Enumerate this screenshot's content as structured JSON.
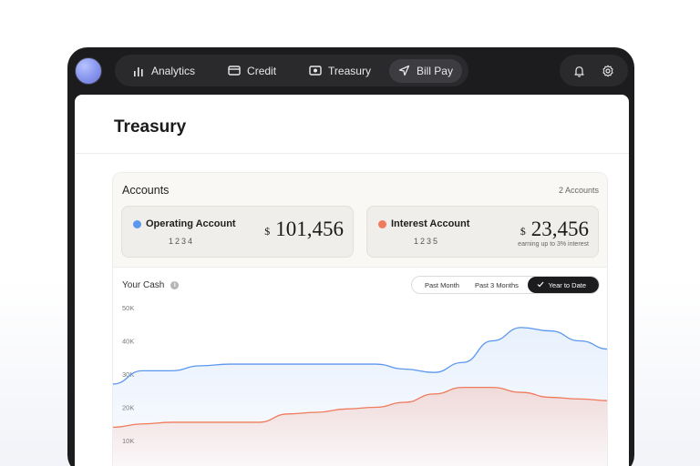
{
  "nav": {
    "items": [
      {
        "label": "Analytics",
        "icon": "bar-chart-icon"
      },
      {
        "label": "Credit",
        "icon": "credit-card-icon"
      },
      {
        "label": "Treasury",
        "icon": "cash-icon"
      },
      {
        "label": "Bill Pay",
        "icon": "send-icon",
        "active": true
      }
    ],
    "utilities": [
      {
        "icon": "bell-icon"
      },
      {
        "icon": "gear-icon"
      }
    ]
  },
  "page": {
    "title": "Treasury"
  },
  "accounts": {
    "title": "Accounts",
    "count_label": "2 Accounts",
    "items": [
      {
        "name": "Operating Account",
        "number": "1234",
        "currency": "$",
        "balance": "101,456",
        "note": "",
        "color": "#5b97ee"
      },
      {
        "name": "Interest Account",
        "number": "1235",
        "currency": "$",
        "balance": "23,456",
        "note": "earning up to 3% interest",
        "color": "#f07a5c"
      }
    ]
  },
  "cash": {
    "label": "Your Cash",
    "ranges": [
      {
        "label": "Past Month"
      },
      {
        "label": "Past 3 Months"
      },
      {
        "label": "Year to Date",
        "active": true
      }
    ]
  },
  "colors": {
    "operating": "#5b97ee",
    "interest": "#f07a5c",
    "dark": "#1c1c1e"
  },
  "chart_data": {
    "type": "area",
    "y_ticks": [
      "50K",
      "40K",
      "30K",
      "20K",
      "10K"
    ],
    "ylim": [
      10000,
      50000
    ],
    "grid": false,
    "series": [
      {
        "name": "Operating Account",
        "color": "#5b97ee",
        "values": [
          27000,
          31000,
          31000,
          32500,
          33000,
          33000,
          33000,
          33000,
          33000,
          33000,
          31500,
          30500,
          33500,
          40000,
          44000,
          43000,
          40000,
          37500
        ]
      },
      {
        "name": "Interest Account",
        "color": "#f07a5c",
        "values": [
          14000,
          15000,
          15500,
          15500,
          15500,
          15500,
          18000,
          18500,
          19500,
          20000,
          21500,
          24000,
          26000,
          26000,
          24500,
          23000,
          22500,
          22000
        ]
      }
    ]
  }
}
